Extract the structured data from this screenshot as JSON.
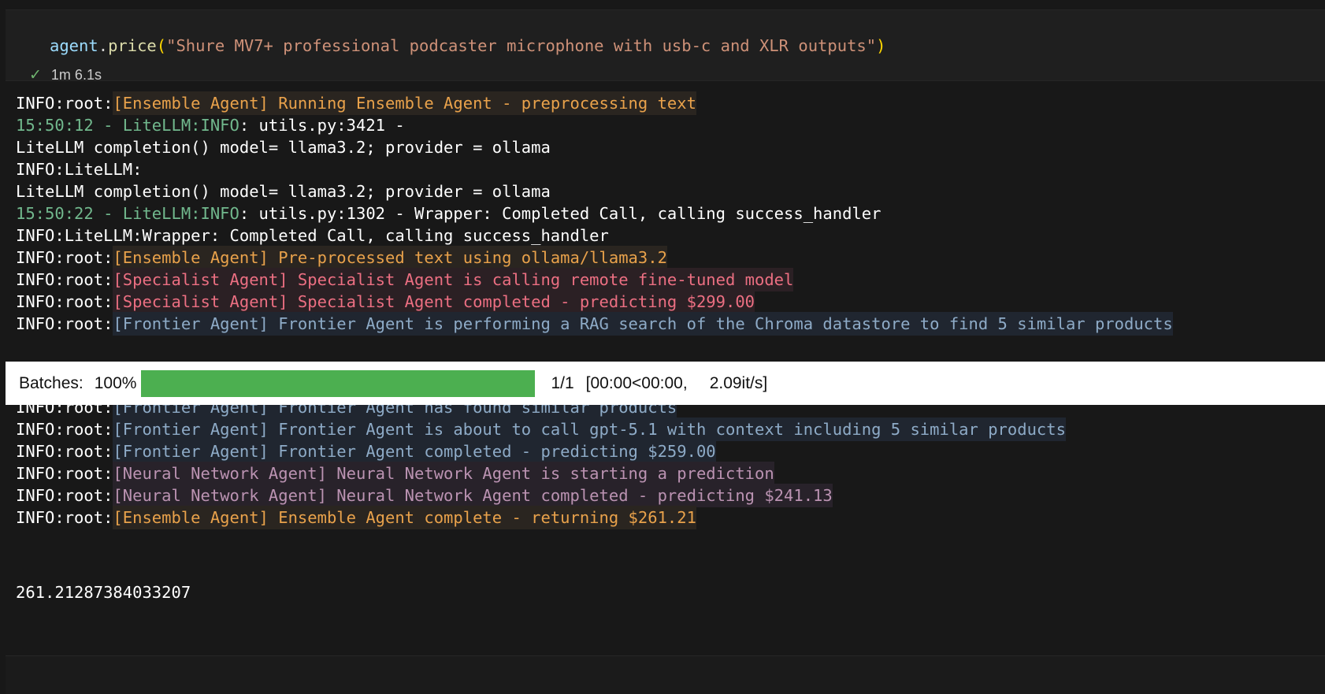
{
  "code_cell": {
    "object": "agent",
    "dot": ".",
    "method": "price",
    "open_paren": "(",
    "argument": "\"Shure MV7+ professional podcaster microphone with usb-c and XLR outputs\"",
    "close_paren": ")",
    "status_icon": "check-icon",
    "duration": "1m 6.1s"
  },
  "colors": {
    "background": "#181818",
    "ensemble": "#e9a24b",
    "specialist": "#ec6f82",
    "frontier": "#8eabc7",
    "neural": "#bb93b2",
    "timestamp": "#71b88d",
    "progress_fill": "#4caf50"
  },
  "log_lines_top": [
    {
      "prefix": "INFO:root:",
      "message": "[Ensemble Agent] Running Ensemble Agent - preprocessing text"
    },
    {
      "timestamp": "15:50:12 - LiteLLM:INFO",
      "rest": ": utils.py:3421 -"
    },
    {
      "text": "LiteLLM completion() model= llama3.2; provider = ollama"
    },
    {
      "text": "INFO:LiteLLM:"
    },
    {
      "text": "LiteLLM completion() model= llama3.2; provider = ollama"
    },
    {
      "timestamp": "15:50:22 - LiteLLM:INFO",
      "rest": ": utils.py:1302 - Wrapper: Completed Call, calling success_handler"
    },
    {
      "text": "INFO:LiteLLM:Wrapper: Completed Call, calling success_handler"
    },
    {
      "prefix": "INFO:root:",
      "message": "[Ensemble Agent] Pre-processed text using ollama/llama3.2"
    },
    {
      "prefix": "INFO:root:",
      "message": "[Specialist Agent] Specialist Agent is calling remote fine-tuned model"
    },
    {
      "prefix": "INFO:root:",
      "message": "[Specialist Agent] Specialist Agent completed - predicting $299.00"
    },
    {
      "prefix": "INFO:root:",
      "message": "[Frontier Agent] Frontier Agent is performing a RAG search of the Chroma datastore to find 5 similar products"
    }
  ],
  "progress": {
    "label": "Batches:",
    "percent_text": "100%",
    "fraction": 1.0,
    "count": "1/1",
    "time": "[00:00<00:00,",
    "rate": "2.09it/s]"
  },
  "log_lines_bottom": [
    {
      "prefix": "INFO:root:",
      "message": "[Frontier Agent] Frontier Agent has found similar products"
    },
    {
      "prefix": "INFO:root:",
      "message": "[Frontier Agent] Frontier Agent is about to call gpt-5.1 with context including 5 similar products"
    },
    {
      "prefix": "INFO:root:",
      "message": "[Frontier Agent] Frontier Agent completed - predicting $259.00"
    },
    {
      "prefix": "INFO:root:",
      "message": "[Neural Network Agent] Neural Network Agent is starting a prediction"
    },
    {
      "prefix": "INFO:root:",
      "message": "[Neural Network Agent] Neural Network Agent completed - predicting $241.13"
    },
    {
      "prefix": "INFO:root:",
      "message": "[Ensemble Agent] Ensemble Agent complete - returning $261.21"
    }
  ],
  "result": "261.21287384033207"
}
